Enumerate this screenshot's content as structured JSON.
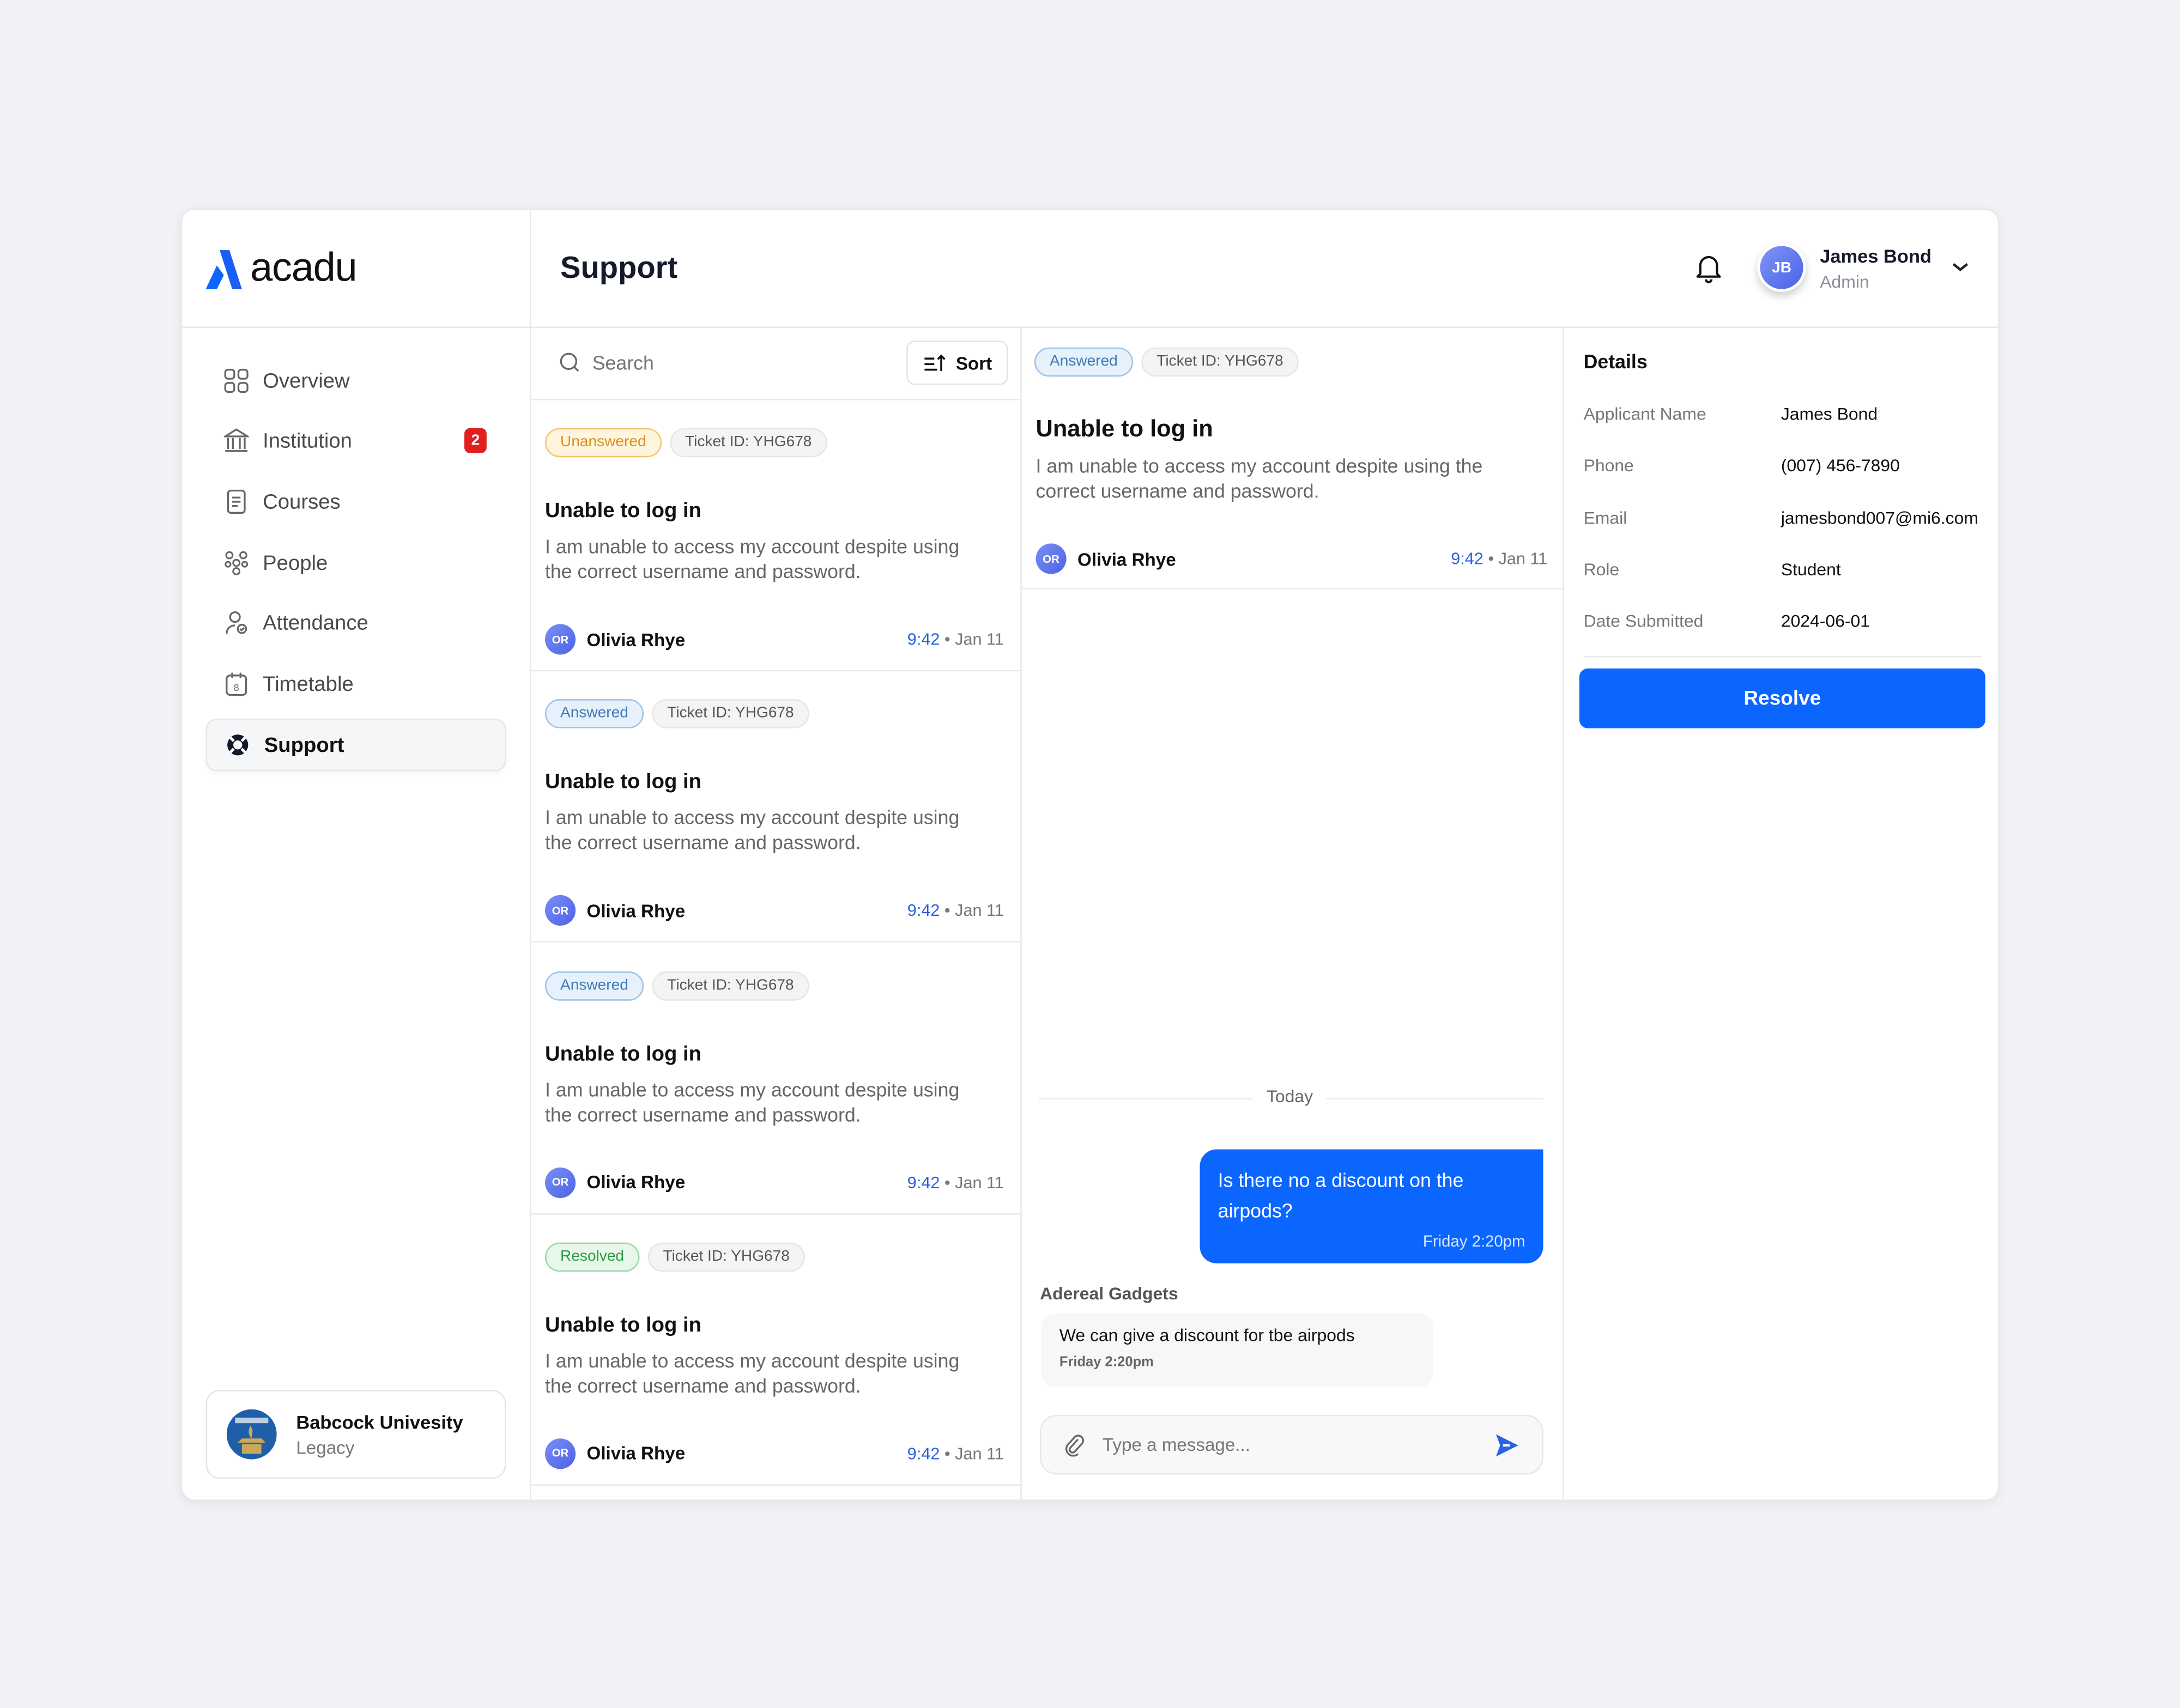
{
  "app": {
    "brand": "acadu",
    "page_title": "Support"
  },
  "user": {
    "initials": "JB",
    "name": "James Bond",
    "role": "Admin"
  },
  "sidebar": {
    "items": [
      {
        "label": "Overview",
        "icon": "grid-icon"
      },
      {
        "label": "Institution",
        "icon": "bank-icon",
        "badge": "2"
      },
      {
        "label": "Courses",
        "icon": "document-icon"
      },
      {
        "label": "People",
        "icon": "people-icon"
      },
      {
        "label": "Attendance",
        "icon": "attendance-icon"
      },
      {
        "label": "Timetable",
        "icon": "calendar-icon"
      },
      {
        "label": "Support",
        "icon": "lifebuoy-icon",
        "active": true
      }
    ],
    "institution": {
      "name": "Babcock Univesity",
      "plan": "Legacy"
    }
  },
  "list": {
    "search_placeholder": "Search",
    "sort_label": "Sort",
    "tickets": [
      {
        "status": "Unanswered",
        "ticket_id": "Ticket ID: YHG678",
        "title": "Unable to log in",
        "desc": "I am unable to access my account despite using the correct username and password.",
        "author_initials": "OR",
        "author": "Olivia Rhye",
        "time": "9:42",
        "date": "• Jan 11"
      },
      {
        "status": "Answered",
        "ticket_id": "Ticket ID: YHG678",
        "title": "Unable to log in",
        "desc": "I am unable to access my account despite using the correct username and password.",
        "author_initials": "OR",
        "author": "Olivia Rhye",
        "time": "9:42",
        "date": "• Jan 11"
      },
      {
        "status": "Answered",
        "ticket_id": "Ticket ID: YHG678",
        "title": "Unable to log in",
        "desc": "I am unable to access my account despite using the correct username and password.",
        "author_initials": "OR",
        "author": "Olivia Rhye",
        "time": "9:42",
        "date": "• Jan 11"
      },
      {
        "status": "Resolved",
        "ticket_id": "Ticket ID: YHG678",
        "title": "Unable to log in",
        "desc": "I am unable to access my account despite using the correct username and password.",
        "author_initials": "OR",
        "author": "Olivia Rhye",
        "time": "9:42",
        "date": "• Jan 11"
      }
    ]
  },
  "conversation": {
    "status": "Answered",
    "ticket_id": "Ticket ID: YHG678",
    "title": "Unable to log in",
    "desc": "I am unable to access my account despite using the correct username and password.",
    "author_initials": "OR",
    "author": "Olivia Rhye",
    "time": "9:42",
    "date": "• Jan 11",
    "day_divider": "Today",
    "messages": [
      {
        "from": "me",
        "text": "Is there no a discount on the airpods?",
        "time": "Friday 2:20pm"
      },
      {
        "from": "other",
        "sender": "Adereal Gadgets",
        "text": "We can give a discount for tbe airpods",
        "time": "Friday 2:20pm"
      }
    ],
    "input_placeholder": "Type a message..."
  },
  "details": {
    "title": "Details",
    "rows": [
      {
        "label": "Applicant Name",
        "value": "James Bond"
      },
      {
        "label": "Phone",
        "value": "(007) 456-7890"
      },
      {
        "label": "Email",
        "value": "jamesbond007@mi6.com"
      },
      {
        "label": "Role",
        "value": "Student"
      },
      {
        "label": "Date Submitted",
        "value": "2024-06-01"
      }
    ],
    "resolve_label": "Resolve"
  },
  "colors": {
    "primary": "#0a66ff",
    "unanswered": "#d9901a",
    "answered": "#3d7ab8",
    "resolved": "#2e9a44",
    "badge": "#e0201f"
  }
}
